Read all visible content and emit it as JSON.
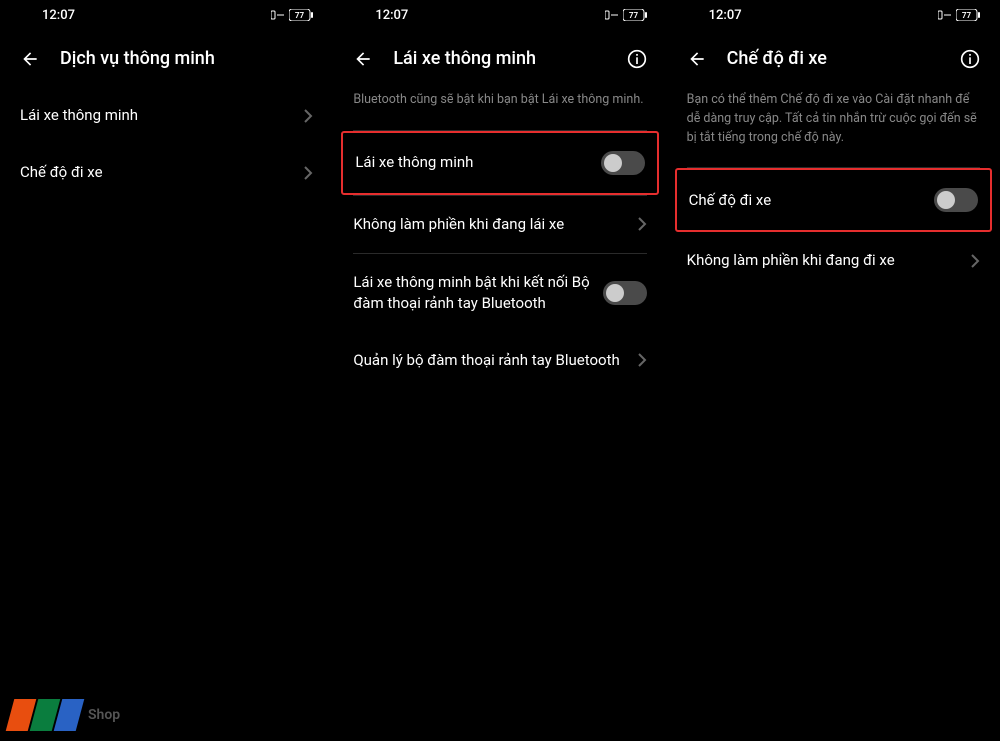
{
  "status": {
    "time": "12:07",
    "battery": "77"
  },
  "screen1": {
    "title": "Dịch vụ thông minh",
    "items": [
      {
        "label": "Lái xe thông minh"
      },
      {
        "label": "Chế độ đi xe"
      }
    ]
  },
  "screen2": {
    "title": "Lái xe thông minh",
    "description": "Bluetooth cũng sẽ bật khi bạn bật Lái xe thông minh.",
    "items": [
      {
        "label": "Lái xe thông minh",
        "type": "toggle",
        "highlighted": true
      },
      {
        "label": "Không làm phiền khi đang lái xe",
        "type": "chevron"
      },
      {
        "label": "Lái xe thông minh bật khi kết nối Bộ đàm thoại rảnh tay Bluetooth",
        "type": "toggle"
      },
      {
        "label": "Quản lý bộ đàm thoại rảnh tay Bluetooth",
        "type": "chevron"
      }
    ]
  },
  "screen3": {
    "title": "Chế độ đi xe",
    "description": "Bạn có thể thêm Chế độ đi xe vào Cài đặt nhanh để dễ dàng truy cập. Tất cả tin nhắn trừ cuộc gọi đến sẽ bị tắt tiếng trong chế độ này.",
    "items": [
      {
        "label": "Chế độ đi xe",
        "type": "toggle",
        "highlighted": true
      },
      {
        "label": "Không làm phiền khi đang đi xe",
        "type": "chevron"
      }
    ]
  },
  "logo": {
    "text": "Shop"
  }
}
